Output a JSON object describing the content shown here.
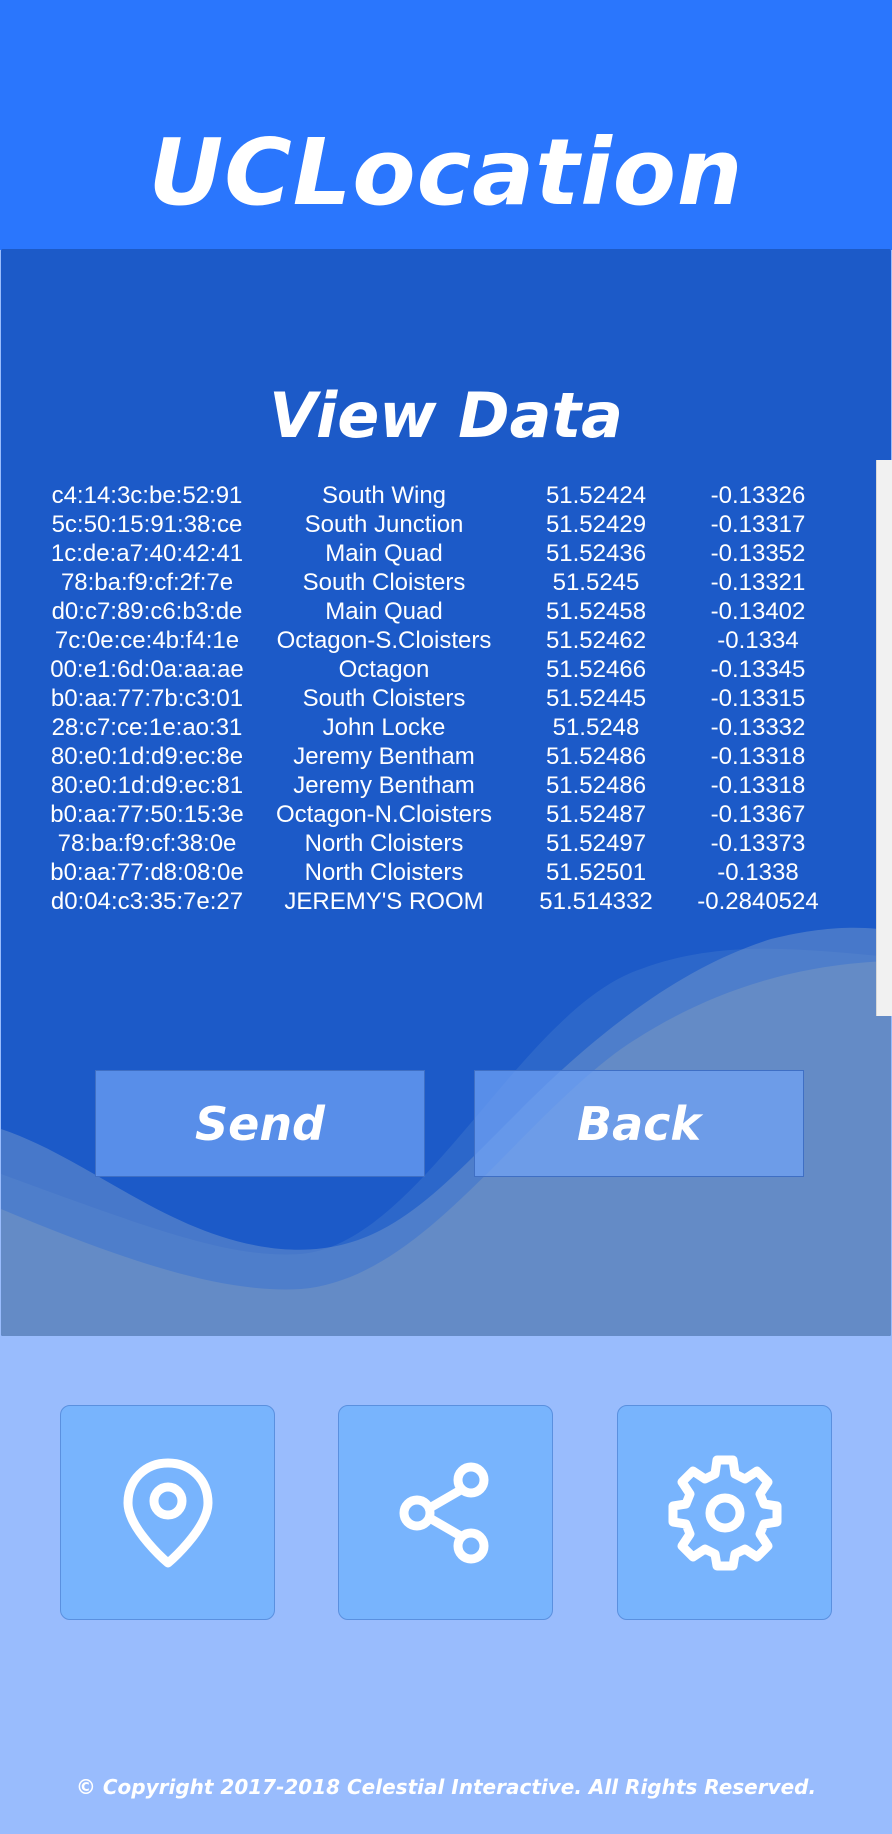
{
  "header": {
    "title": "UCLocation"
  },
  "panel": {
    "title": "View Data"
  },
  "rows": [
    {
      "mac": "c4:14:3c:be:52:91",
      "location": "South Wing",
      "lat": "51.52424",
      "lon": "-0.13326"
    },
    {
      "mac": "5c:50:15:91:38:ce",
      "location": "South Junction",
      "lat": "51.52429",
      "lon": "-0.13317"
    },
    {
      "mac": "1c:de:a7:40:42:41",
      "location": "Main Quad",
      "lat": "51.52436",
      "lon": "-0.13352"
    },
    {
      "mac": "78:ba:f9:cf:2f:7e",
      "location": "South Cloisters",
      "lat": "51.5245",
      "lon": "-0.13321"
    },
    {
      "mac": "d0:c7:89:c6:b3:de",
      "location": "Main Quad",
      "lat": "51.52458",
      "lon": "-0.13402"
    },
    {
      "mac": "7c:0e:ce:4b:f4:1e",
      "location": "Octagon-S.Cloisters",
      "lat": "51.52462",
      "lon": "-0.1334"
    },
    {
      "mac": "00:e1:6d:0a:aa:ae",
      "location": "Octagon",
      "lat": "51.52466",
      "lon": "-0.13345"
    },
    {
      "mac": "b0:aa:77:7b:c3:01",
      "location": "South Cloisters",
      "lat": "51.52445",
      "lon": "-0.13315"
    },
    {
      "mac": "28:c7:ce:1e:ao:31",
      "location": "John Locke",
      "lat": "51.5248",
      "lon": "-0.13332"
    },
    {
      "mac": "80:e0:1d:d9:ec:8e",
      "location": "Jeremy Bentham",
      "lat": "51.52486",
      "lon": "-0.13318"
    },
    {
      "mac": "80:e0:1d:d9:ec:81",
      "location": "Jeremy Bentham",
      "lat": "51.52486",
      "lon": "-0.13318"
    },
    {
      "mac": "b0:aa:77:50:15:3e",
      "location": "Octagon-N.Cloisters",
      "lat": "51.52487",
      "lon": "-0.13367"
    },
    {
      "mac": "78:ba:f9:cf:38:0e",
      "location": "North Cloisters",
      "lat": "51.52497",
      "lon": "-0.13373"
    },
    {
      "mac": "b0:aa:77:d8:08:0e",
      "location": "North Cloisters",
      "lat": "51.52501",
      "lon": "-0.1338"
    },
    {
      "mac": "d0:04:c3:35:7e:27",
      "location": "JEREMY'S ROOM",
      "lat": "51.514332",
      "lon": "-0.2840524"
    }
  ],
  "buttons": {
    "send": "Send",
    "back": "Back"
  },
  "nav": [
    {
      "icon": "location-pin-icon"
    },
    {
      "icon": "share-icon"
    },
    {
      "icon": "gear-icon"
    }
  ],
  "footer": {
    "copyright": "© Copyright 2017-2018 Celestial Interactive. All Rights Reserved."
  },
  "colors": {
    "header_bg": "#2a76fd",
    "panel_bg": "#1c5ac8",
    "page_bg": "#99bcfd",
    "tile_bg": "#78b4fd"
  }
}
